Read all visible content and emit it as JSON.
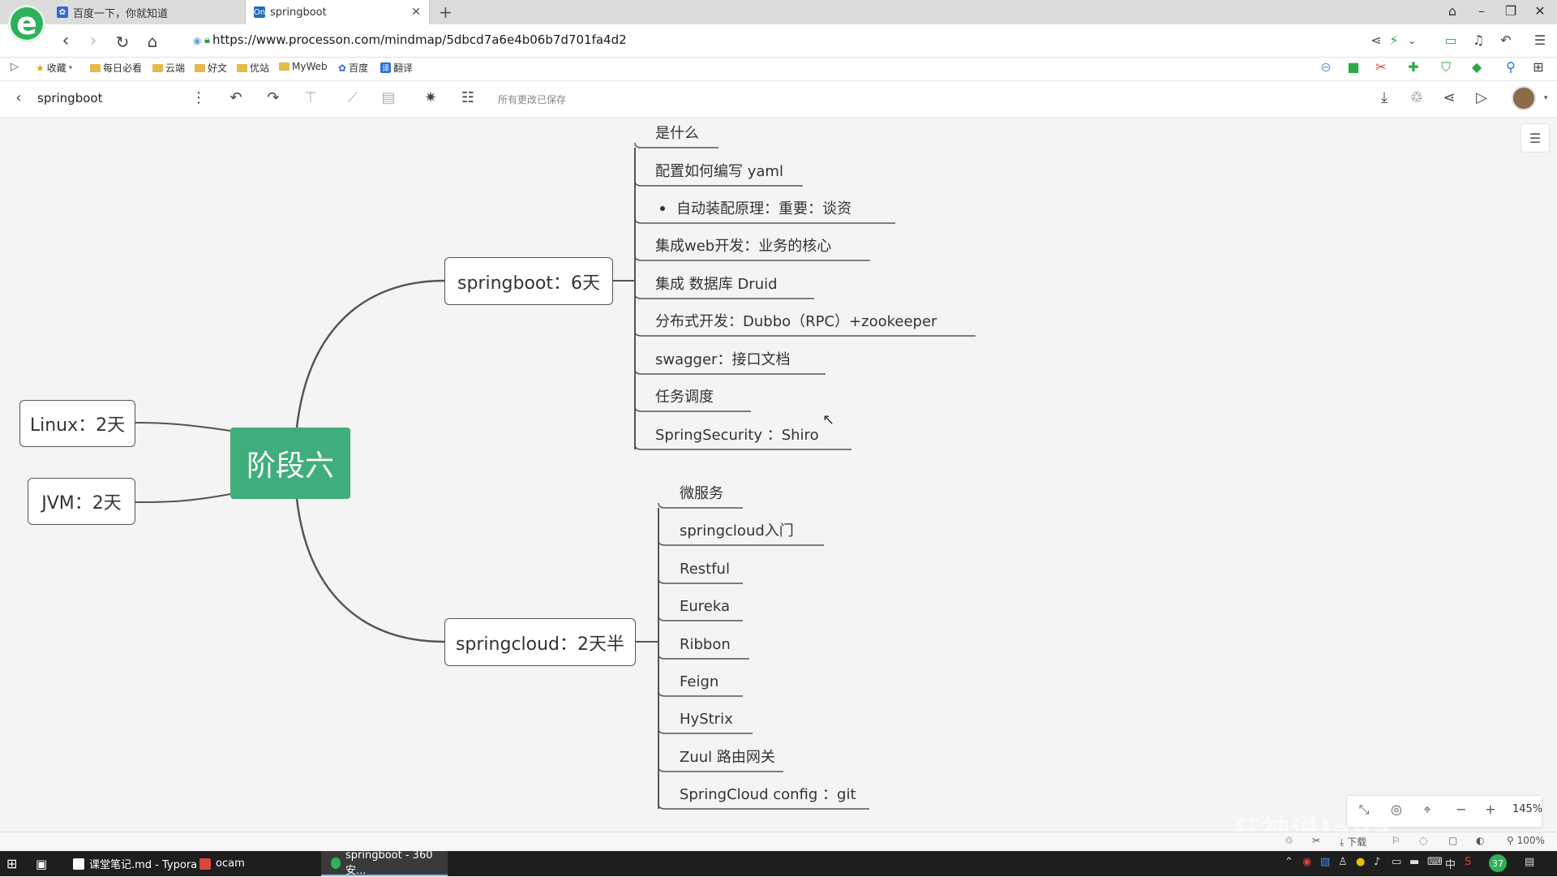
{
  "browser": {
    "logo_glyph": "e",
    "tabs": [
      {
        "label": "百度一下，你就知道",
        "icon": "paw-icon",
        "active": false
      },
      {
        "label": "springboot",
        "icon": "processon-icon",
        "icon_text": "On",
        "active": true
      }
    ],
    "new_tab": "+",
    "url": "https://www.processon.com/mindmap/5dbcd7a6e4b06b7d701fa4d2",
    "bookmarks": [
      {
        "label": "收藏",
        "type": "star"
      },
      {
        "label": "每日必看",
        "type": "folder"
      },
      {
        "label": "云端",
        "type": "folder"
      },
      {
        "label": "好文",
        "type": "folder"
      },
      {
        "label": "优站",
        "type": "folder"
      },
      {
        "label": "MyWeb",
        "type": "folder"
      },
      {
        "label": "百度",
        "type": "paw"
      },
      {
        "label": "翻译",
        "type": "translate"
      }
    ]
  },
  "app": {
    "title": "springboot",
    "saved_status": "所有更改已保存"
  },
  "mindmap": {
    "root": "阶段六",
    "left_nodes": [
      "Linux：2天",
      "JVM：2天"
    ],
    "branches": [
      {
        "label": "springboot：6天",
        "children": [
          "是什么",
          "配置如何编写  yaml",
          "自动装配原理：重要：谈资",
          "集成web开发：业务的核心",
          "集成 数据库 Druid",
          "分布式开发：Dubbo（RPC）+zookeeper",
          "swagger：接口文档",
          "任务调度",
          "SpringSecurity ：Shiro"
        ]
      },
      {
        "label": "springcloud：2天半",
        "children": [
          "微服务",
          "springcloud入门",
          "Restful",
          "Eureka",
          "Ribbon",
          "Feign",
          "HyStrix",
          "Zuul 路由网关",
          "SpringCloud config ：git"
        ]
      }
    ]
  },
  "zoom": {
    "value": "145%"
  },
  "statusbar": {
    "download": "下载",
    "zoom": "100%"
  },
  "watermark": "狂神说Java",
  "taskbar": {
    "items": [
      {
        "label": "课堂笔记.md - Typora"
      },
      {
        "label": "ocam"
      },
      {
        "label": "springboot - 360安..."
      }
    ],
    "tray_badge": "37",
    "ime": "中"
  },
  "colors": {
    "root": "#3fae7b",
    "line": "#555555"
  }
}
